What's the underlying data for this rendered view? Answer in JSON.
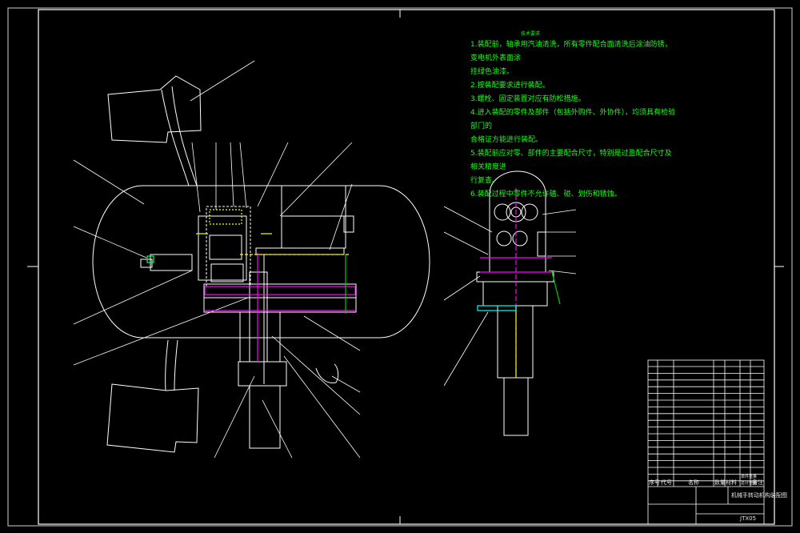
{
  "drawing": {
    "tech_requirements": {
      "heading": "技术要求",
      "items": [
        "1.装配前，轴承用汽油清洗，所有零件配合面清洗后涂油防锈，变电机外表面涂",
        "挂绿色油漆。",
        "2.按装配要求进行装配。",
        "3.螺栓、固定装置对应有防松措施。",
        "4.进入装配的零件及部件（包括外购件、外协件），均须具有检验部门的",
        "合格证方能进行装配。",
        "5.装配前应对零、部件的主要配合尺寸，特别是过盈配合尺寸及相关精度进",
        "行复查。",
        "6.装配过程中零件不允许磕、碰、划伤和锈蚀。"
      ]
    },
    "title_block": {
      "header_cols": [
        "序号",
        "代号",
        "名称",
        "数量",
        "材料",
        "单件重量",
        "总计重量",
        "备注"
      ],
      "drawing_title": "机械手转动机构装配图",
      "drawing_number": "JTX05"
    },
    "colors": {
      "line": "#ffffff",
      "text_green": "#19ff19",
      "accent_magenta": "#ff00ff",
      "accent_yellow": "#ffff00",
      "accent_cyan": "#00ffff",
      "accent_green": "#00cc00"
    }
  }
}
